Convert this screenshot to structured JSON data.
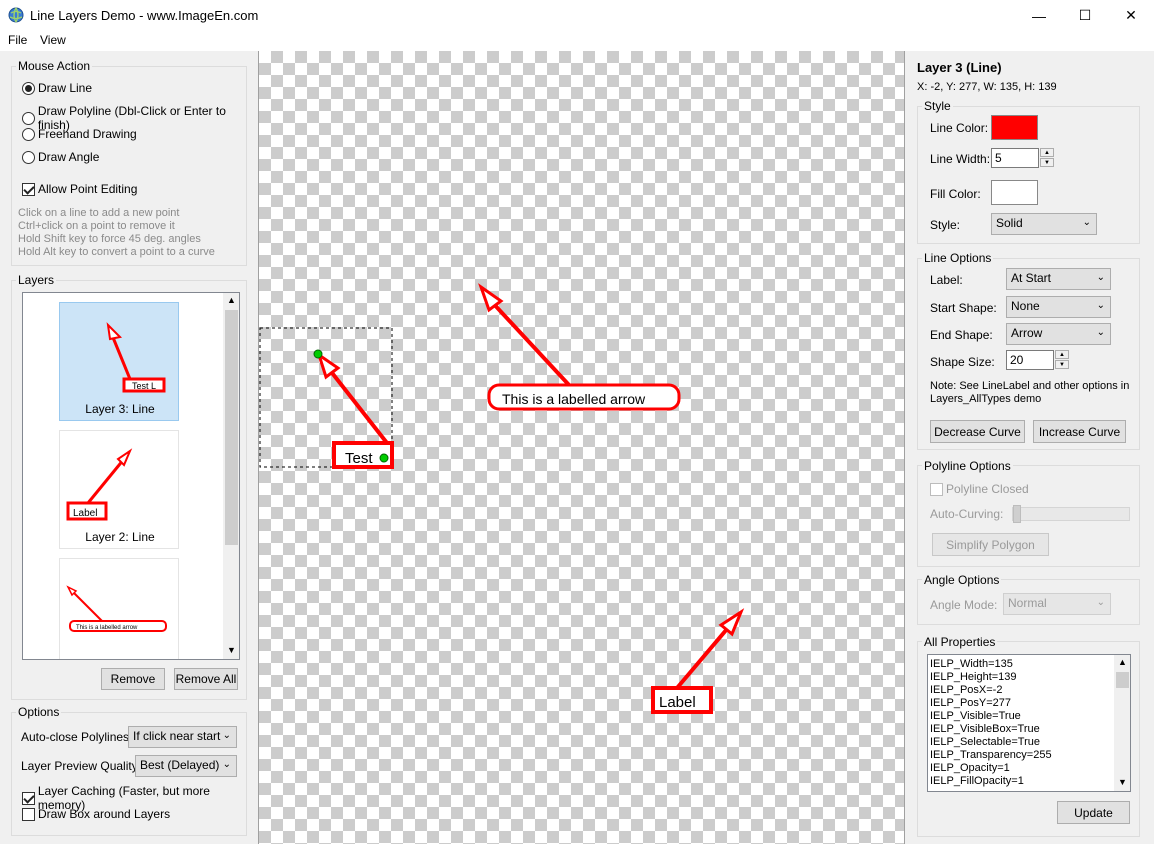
{
  "window": {
    "title": "Line Layers Demo  - www.ImageEn.com",
    "minimize": "—",
    "maximize": "☐",
    "close": "✕"
  },
  "menu": {
    "file": "File",
    "view": "View"
  },
  "mouse_action": {
    "title": "Mouse Action",
    "options": [
      "Draw Line",
      "Draw Polyline (Dbl-Click or Enter to finish)",
      "Freehand Drawing",
      "Draw Angle"
    ],
    "selected": "Draw Line",
    "allow_point_editing": "Allow Point Editing",
    "hints": [
      "Click on a line to add a new point",
      "Ctrl+click on a point to remove it",
      "Hold Shift key to force 45 deg. angles",
      "Hold Alt key to convert a point to a curve"
    ]
  },
  "layers": {
    "title": "Layers",
    "items": [
      {
        "caption": "Layer 3: Line",
        "thumb_text": "Test L"
      },
      {
        "caption": "Layer 2: Line",
        "thumb_text": "Label"
      },
      {
        "caption": "",
        "thumb_text": "This is a labelled arrow"
      }
    ],
    "remove": "Remove",
    "remove_all": "Remove All"
  },
  "options": {
    "title": "Options",
    "auto_close_label": "Auto-close Polylines:",
    "auto_close_value": "If click near start",
    "preview_quality_label": "Layer Preview Quality:",
    "preview_quality_value": "Best (Delayed)",
    "layer_caching": "Layer Caching (Faster, but more memory)",
    "draw_box": "Draw Box around Layers"
  },
  "canvas": {
    "labels": [
      "This is a labelled arrow",
      "Test",
      "Label"
    ],
    "colors": {
      "line": "#ff0000",
      "handle": "#00cc00"
    }
  },
  "props": {
    "header": "Layer 3 (Line)",
    "geometry": "X: -2, Y: 277, W: 135, H: 139",
    "style": {
      "title": "Style",
      "line_color_label": "Line Color:",
      "line_color": "#ff0000",
      "line_width_label": "Line Width:",
      "line_width": "5",
      "fill_color_label": "Fill Color:",
      "fill_color": "#ffffff",
      "style_label": "Style:",
      "style_value": "Solid"
    },
    "line_options": {
      "title": "Line Options",
      "label_label": "Label:",
      "label_value": "At Start",
      "start_shape_label": "Start Shape:",
      "start_shape_value": "None",
      "end_shape_label": "End Shape:",
      "end_shape_value": "Arrow",
      "shape_size_label": "Shape Size:",
      "shape_size_value": "20",
      "note1": "Note: See LineLabel and other options in",
      "note2": "Layers_AllTypes demo",
      "decrease": "Decrease Curve",
      "increase": "Increase Curve"
    },
    "polyline_options": {
      "title": "Polyline Options",
      "closed": "Polyline Closed",
      "auto_curving": "Auto-Curving:",
      "simplify": "Simplify Polygon"
    },
    "angle_options": {
      "title": "Angle Options",
      "mode_label": "Angle Mode:",
      "mode_value": "Normal"
    },
    "all_properties": {
      "title": "All Properties",
      "lines": [
        "IELP_Width=135",
        "IELP_Height=139",
        "IELP_PosX=-2",
        "IELP_PosY=277",
        "IELP_Visible=True",
        "IELP_VisibleBox=True",
        "IELP_Selectable=True",
        "IELP_Transparency=255",
        "IELP_Opacity=1",
        "IELP_FillOpacity=1"
      ],
      "update": "Update"
    }
  }
}
